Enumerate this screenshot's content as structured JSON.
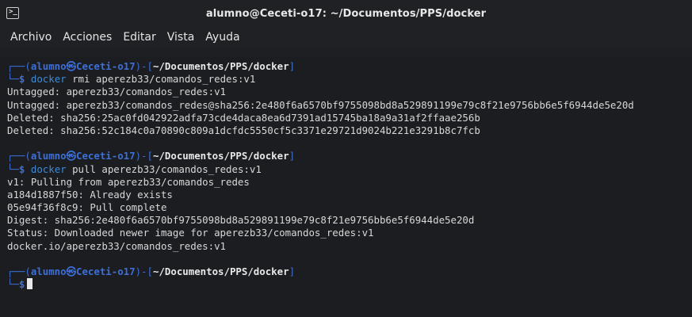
{
  "window": {
    "title": "alumno@Ceceti-o17: ~/Documentos/PPS/docker",
    "icon": "terminal-icon"
  },
  "menu": [
    {
      "label": "Archivo"
    },
    {
      "label": "Acciones"
    },
    {
      "label": "Editar"
    },
    {
      "label": "Vista"
    },
    {
      "label": "Ayuda"
    }
  ],
  "prompt": {
    "box_top": "┌──(",
    "user_host": "alumno㉿Ceceti-o17",
    "mid": ")-[",
    "path": "~/Documentos/PPS/docker",
    "end": "]",
    "box_bottom": "└─",
    "dollar": "$"
  },
  "blocks": [
    {
      "command": "docker",
      "args": " rmi aperezb33/comandos_redes:v1",
      "output": [
        "Untagged: aperezb33/comandos_redes:v1",
        "Untagged: aperezb33/comandos_redes@sha256:2e480f6a6570bf9755098bd8a529891199e79c8f21e9756bb6e5f6944de5e20d",
        "Deleted: sha256:25ac0fd042922adfa73cde4daca8ea6d7391ad15745ba18a9a31af2ffaae256b",
        "Deleted: sha256:52c184c0a70890c809a1dcfdc5550cf5c3371e29721d9024b221e3291b8c7fcb"
      ]
    },
    {
      "command": "docker",
      "args": " pull aperezb33/comandos_redes:v1",
      "output": [
        "v1: Pulling from aperezb33/comandos_redes",
        "a184d1887f50: Already exists",
        "05e94f36f8c9: Pull complete",
        "Digest: sha256:2e480f6a6570bf9755098bd8a529891199e79c8f21e9756bb6e5f6944de5e20d",
        "Status: Downloaded newer image for aperezb33/comandos_redes:v1",
        "docker.io/aperezb33/comandos_redes:v1"
      ]
    }
  ]
}
